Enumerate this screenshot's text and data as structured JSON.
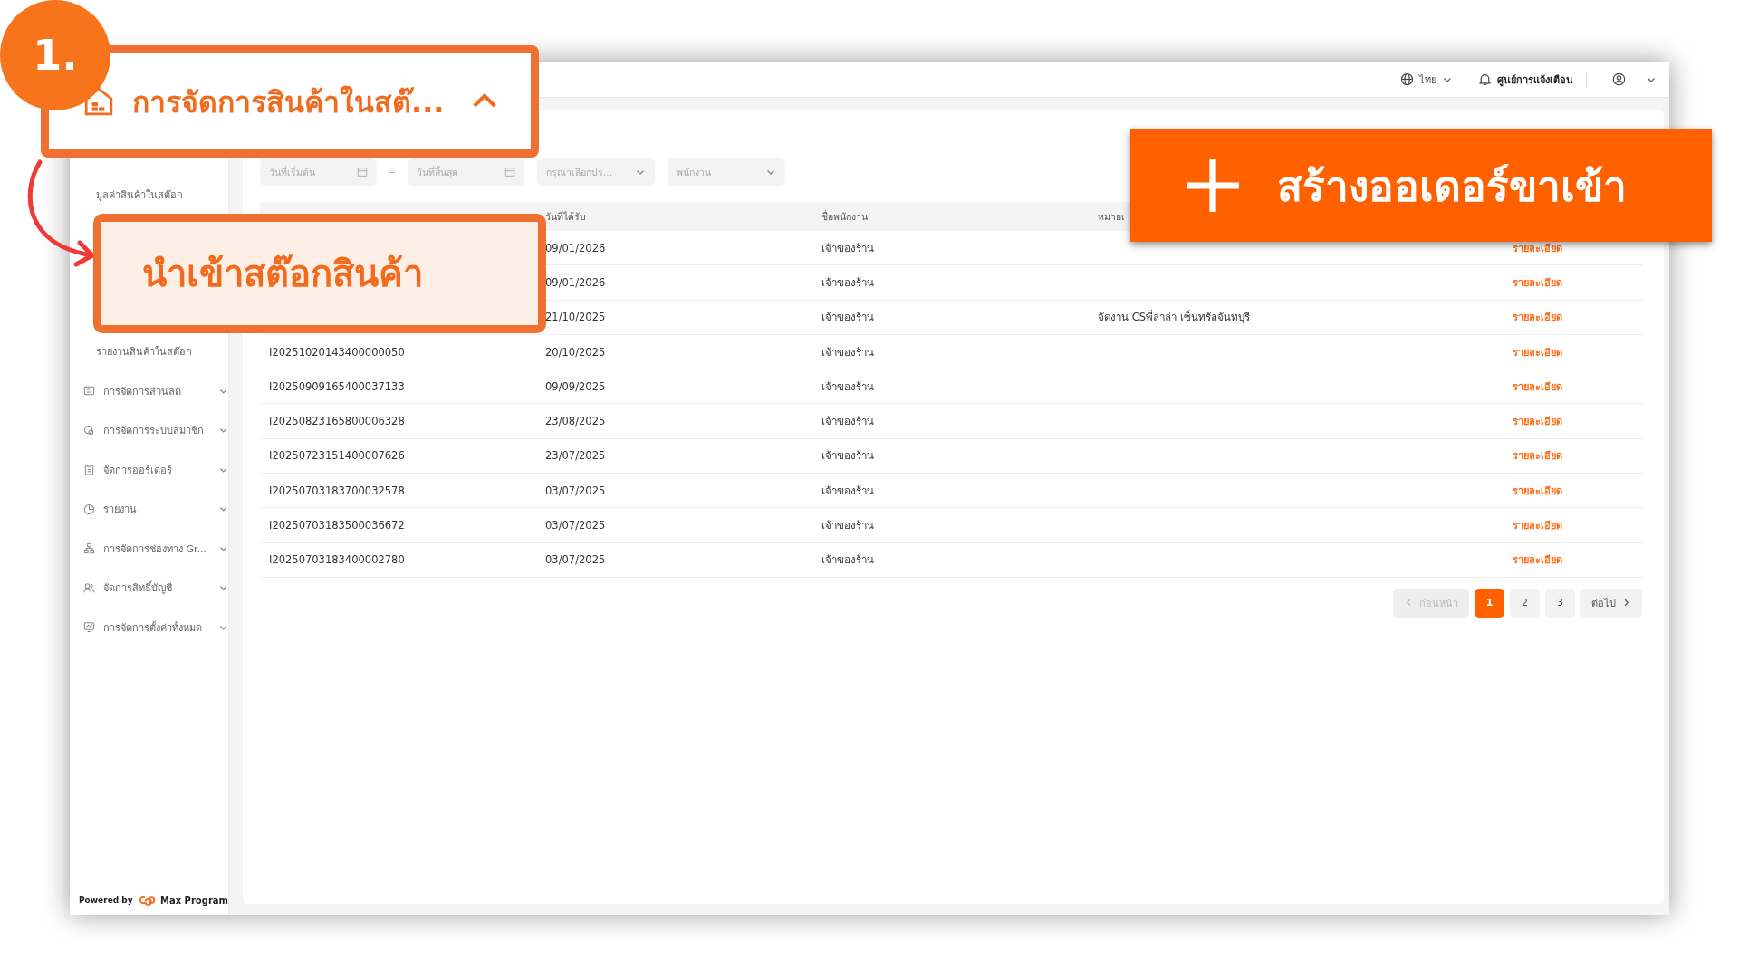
{
  "annotations": {
    "step": "1.",
    "menu_callout": {
      "label": "การจัดการสินค้าในสต๊...",
      "expanded": true
    },
    "item_callout": {
      "label": "นำเข้าสต๊อกสินค้า"
    },
    "action_banner": {
      "label": "สร้างออเดอร์ขาเข้า"
    }
  },
  "topbar": {
    "language": "ไทย",
    "notifications": "ศูนย์การแจ้งเตือน"
  },
  "sidebar": {
    "sub_items": [
      {
        "label": "มูลค่าสินค้าในสต๊อก"
      },
      {
        "label": "รายงานสินค้าในสต๊อก"
      }
    ],
    "groups": [
      {
        "kind": "discount",
        "label": "การจัดการส่วนลด",
        "expanded": false
      },
      {
        "kind": "member",
        "label": "การจัดการระบบสมาชิก",
        "expanded": false
      },
      {
        "kind": "order",
        "label": "จัดการออร์เดอร์",
        "expanded": false
      },
      {
        "kind": "report",
        "label": "รายงาน",
        "expanded": false
      },
      {
        "kind": "channel",
        "label": "การจัดการช่องทาง Gr...",
        "expanded": false
      },
      {
        "kind": "account",
        "label": "จัดการสิทธิ์บัญชี",
        "expanded": false
      },
      {
        "kind": "settings",
        "label": "การจัดการตั้งค่าทั้งหมด",
        "expanded": false
      }
    ],
    "footer": {
      "powered_by": "Powered by",
      "brand": "Max Program"
    }
  },
  "filters": [
    {
      "kind": "date",
      "placeholder": "วันที่เริ่มต้น"
    },
    {
      "kind": "separator",
      "text": "–"
    },
    {
      "kind": "date",
      "placeholder": "วันที่สิ้นสุด"
    },
    {
      "kind": "select",
      "placeholder": "กรุณาเลือกปร..."
    },
    {
      "kind": "select",
      "placeholder": "พนักงาน"
    }
  ],
  "table": {
    "columns": [
      "วันที่ได้รับ",
      "ชื่อพนักงาน",
      "หมายเ"
    ],
    "rows": [
      {
        "date": "09/01/2026",
        "employee": "เจ้าของร้าน",
        "action": "รายละเอียด"
      },
      {
        "date": "09/01/2026",
        "employee": "เจ้าของร้าน",
        "action": "รายละเอียด"
      },
      {
        "date": "21/10/2025",
        "employee": "เจ้าของร้าน",
        "note": "จัดงาน CSพี่ลาล่า เซ็นทรัลจันทบุรี",
        "action": "รายละเอียด"
      },
      {
        "id": "I20251020143400000050",
        "date": "20/10/2025",
        "employee": "เจ้าของร้าน",
        "action": "รายละเอียด"
      },
      {
        "id": "I20250909165400037133",
        "date": "09/09/2025",
        "employee": "เจ้าของร้าน",
        "action": "รายละเอียด"
      },
      {
        "id": "I20250823165800006328",
        "date": "23/08/2025",
        "employee": "เจ้าของร้าน",
        "action": "รายละเอียด"
      },
      {
        "id": "I20250723151400007626",
        "date": "23/07/2025",
        "employee": "เจ้าของร้าน",
        "action": "รายละเอียด"
      },
      {
        "id": "I20250703183700032578",
        "date": "03/07/2025",
        "employee": "เจ้าของร้าน",
        "action": "รายละเอียด"
      },
      {
        "id": "I20250703183500036672",
        "date": "03/07/2025",
        "employee": "เจ้าของร้าน",
        "action": "รายละเอียด"
      },
      {
        "id": "I20250703183400002780",
        "date": "03/07/2025",
        "employee": "เจ้าของร้าน",
        "action": "รายละเอียด"
      }
    ]
  },
  "pagination": {
    "previous": {
      "label": "ก่อนหน้า",
      "disabled": true
    },
    "pages": [
      {
        "label": "1",
        "selected": true
      },
      {
        "label": "2",
        "selected": false
      },
      {
        "label": "3",
        "selected": false
      }
    ],
    "next": {
      "label": "ต่อไป",
      "disabled": false
    }
  }
}
